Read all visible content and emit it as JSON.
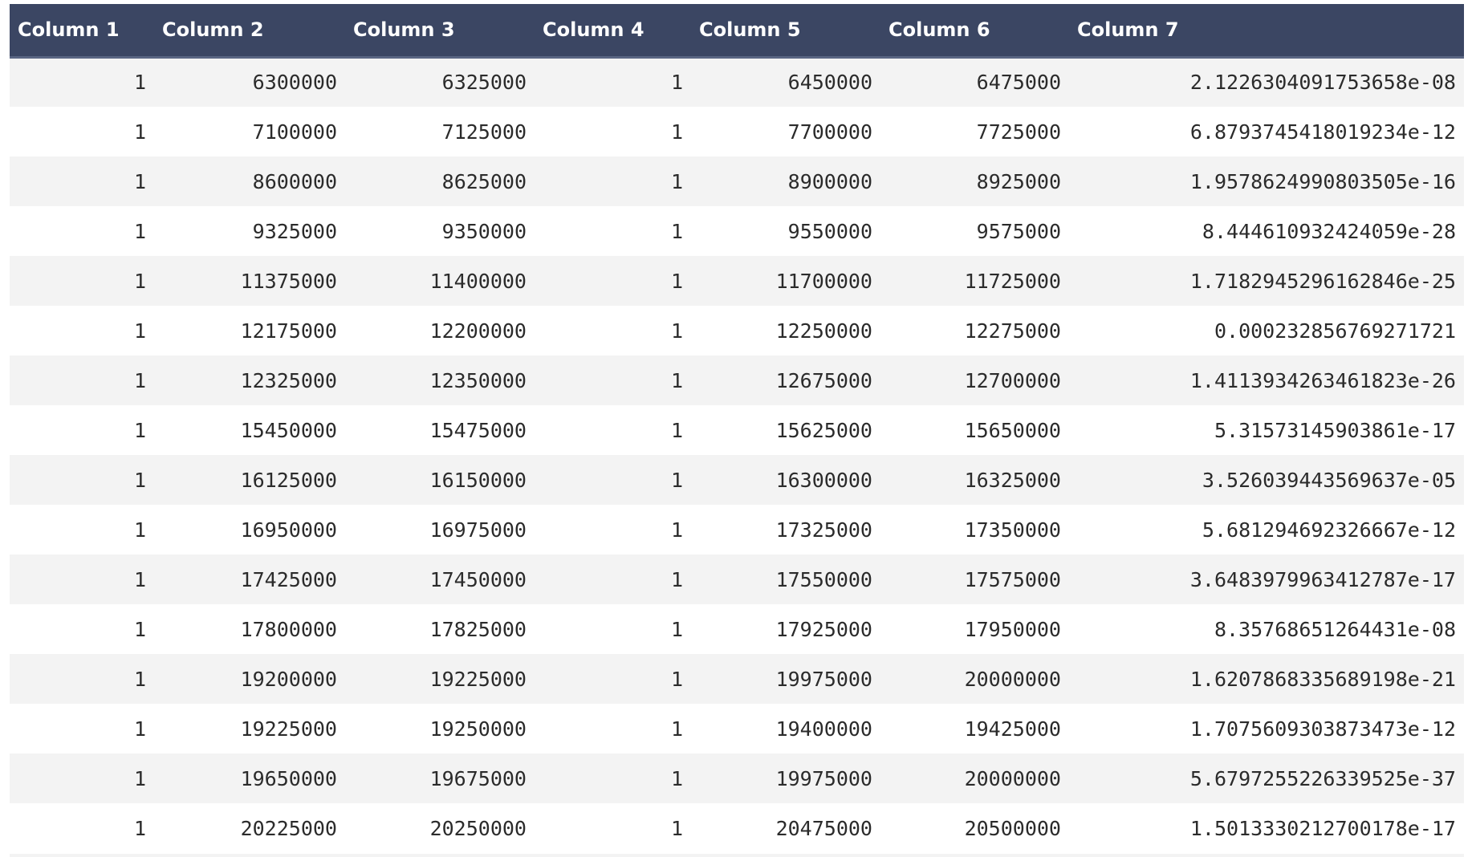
{
  "table": {
    "headers": [
      "Column 1",
      "Column 2",
      "Column 3",
      "Column 4",
      "Column 5",
      "Column 6",
      "Column 7"
    ],
    "rows": [
      [
        "1",
        "6300000",
        "6325000",
        "1",
        "6450000",
        "6475000",
        "2.122630409175365­8e-08"
      ],
      [
        "1",
        "7100000",
        "7125000",
        "1",
        "7700000",
        "7725000",
        "6.8793745418019234e-12"
      ],
      [
        "1",
        "8600000",
        "8625000",
        "1",
        "8900000",
        "8925000",
        "1.9578624990803505e-16"
      ],
      [
        "1",
        "9325000",
        "9350000",
        "1",
        "9550000",
        "9575000",
        "8.444610932424059e-28"
      ],
      [
        "1",
        "11375000",
        "11400000",
        "1",
        "11700000",
        "11725000",
        "1.7182945296162846e-25"
      ],
      [
        "1",
        "12175000",
        "12200000",
        "1",
        "12250000",
        "12275000",
        "0.000232856769271721"
      ],
      [
        "1",
        "12325000",
        "12350000",
        "1",
        "12675000",
        "12700000",
        "1.4113934263461823e-26"
      ],
      [
        "1",
        "15450000",
        "15475000",
        "1",
        "15625000",
        "15650000",
        "5.31573145903861e-17"
      ],
      [
        "1",
        "16125000",
        "16150000",
        "1",
        "16300000",
        "16325000",
        "3.526039443569637e-05"
      ],
      [
        "1",
        "16950000",
        "16975000",
        "1",
        "17325000",
        "17350000",
        "5.681294692326667e-12"
      ],
      [
        "1",
        "17425000",
        "17450000",
        "1",
        "17550000",
        "17575000",
        "3.6483979963412787e-17"
      ],
      [
        "1",
        "17800000",
        "17825000",
        "1",
        "17925000",
        "17950000",
        "8.35768651264431e-08"
      ],
      [
        "1",
        "19200000",
        "19225000",
        "1",
        "19975000",
        "20000000",
        "1.6207868335689198e-21"
      ],
      [
        "1",
        "19225000",
        "19250000",
        "1",
        "19400000",
        "19425000",
        "1.7075609303873473e-12"
      ],
      [
        "1",
        "19650000",
        "19675000",
        "1",
        "19975000",
        "20000000",
        "5.6797255226339525e-37"
      ],
      [
        "1",
        "20225000",
        "20250000",
        "1",
        "20475000",
        "20500000",
        "1.5013330212700178e-17"
      ]
    ]
  }
}
